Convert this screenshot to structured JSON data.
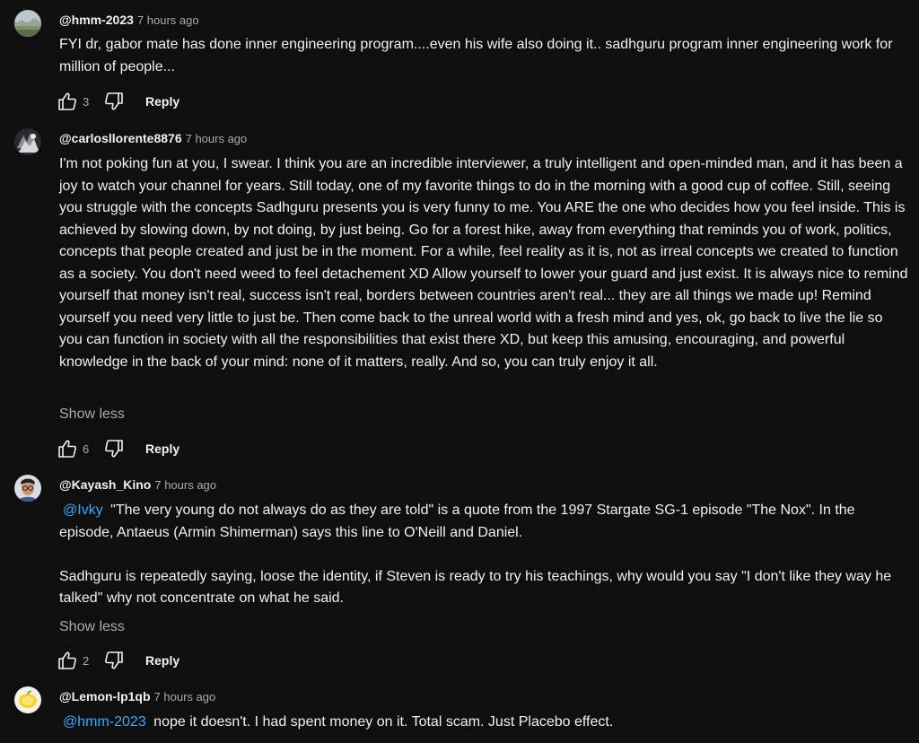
{
  "comments": [
    {
      "author": "@hmm-2023",
      "time": "7 hours ago",
      "avatar_icon": "landscape-photo-avatar",
      "paragraphs": [
        "FYI  dr, gabor mate  has done inner engineering program....even his wife also doing it.. sadhguru program inner engineering work for million of people..."
      ],
      "likes": "3",
      "reply_label": "Reply"
    },
    {
      "author": "@carlosllorente8876",
      "time": "7 hours ago",
      "avatar_icon": "dark-illustration-avatar",
      "paragraphs": [
        "I'm not poking fun at you, I swear. I think you are an incredible interviewer, a truly intelligent and open-minded man, and it has been a joy to watch your channel for years. Still today, one of my favorite things to do in the morning with a good cup of coffee. Still, seeing you struggle with the concepts Sadhguru presents you is very funny to me. You ARE the one who decides how you feel inside. This is achieved by slowing down, by not doing, by just being. Go for a forest hike, away from everything that reminds you of work, politics, concepts that people created and just be in the moment. For a while, feel reality as it is, not as irreal concepts we created to function as a society. You don't need weed to feel detachement XD Allow yourself to lower your guard and just exist. It is always nice to remind yourself that money isn't real, success isn't real, borders between countries aren't real... they are all things we made up! Remind yourself you need very little to just be. Then come back to the unreal world with a fresh mind and yes, ok, go back to live the lie so you can function in society with all the responsibilities that exist there XD, but keep this amusing, encouraging, and powerful knowledge in the back of your mind: none of it matters, really. And so, you can truly enjoy it all."
      ],
      "show_less": "Show less",
      "likes": "6",
      "reply_label": "Reply"
    },
    {
      "author": "@Kayash_Kino",
      "time": "7 hours ago",
      "avatar_icon": "person-with-glasses-avatar",
      "mention": "@Ivky",
      "paragraphs": [
        "\"The very young do not always do as they are told\" is a quote from the 1997 Stargate SG-1 episode \"The Nox\". In the episode, Antaeus (Armin Shimerman) says this line to O'Neill and Daniel.",
        "Sadhguru is repeatedly saying, loose the identity, if Steven is ready to try his teachings, why would you say \"I don't like they way he talked\" why not concentrate on what he said."
      ],
      "show_less": "Show less",
      "likes": "2",
      "reply_label": "Reply"
    },
    {
      "author": "@Lemon-lp1qb",
      "time": "7 hours ago",
      "avatar_icon": "lemon-avatar",
      "mention": "@hmm-2023",
      "paragraphs": [
        "nope it doesn't. I had spent money on it. Total scam. Just Placebo effect."
      ]
    }
  ],
  "colors": {
    "background": "#0f0f0f",
    "text": "#f1f1f1",
    "secondary": "#aaaaaa",
    "link": "#3ea6ff"
  }
}
